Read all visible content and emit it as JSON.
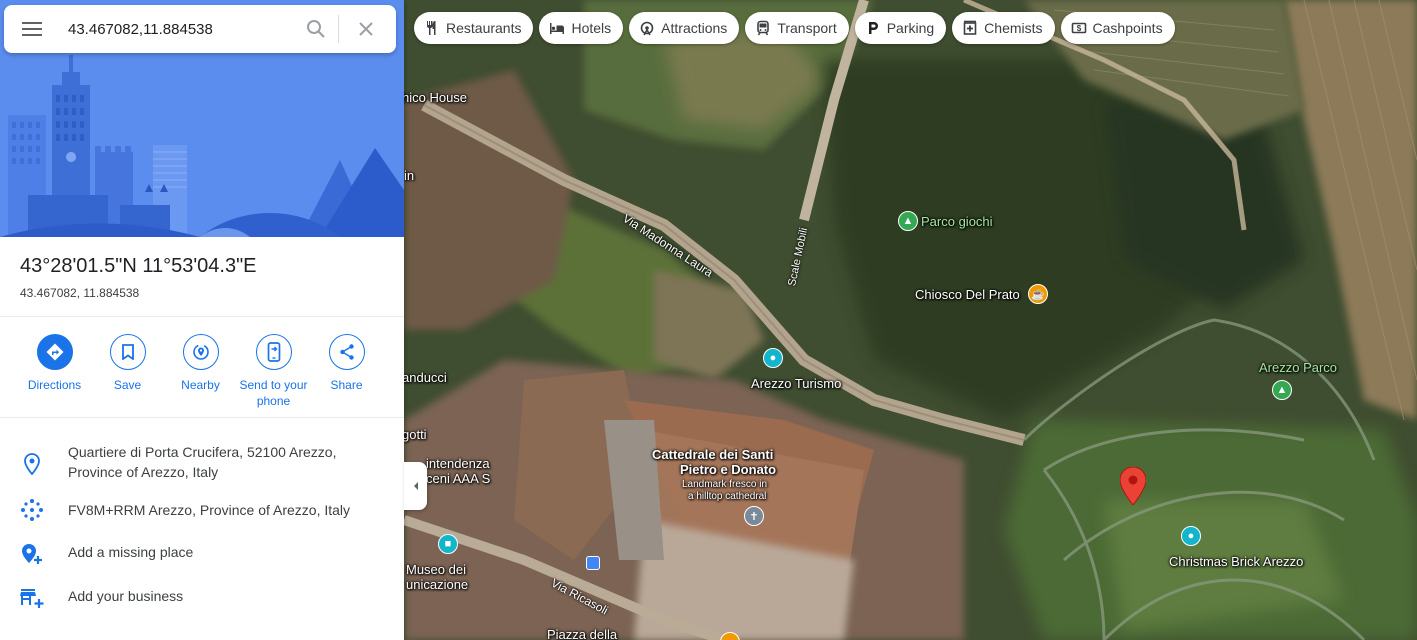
{
  "search": {
    "value": "43.467082,11.884538",
    "menu_icon": "menu-icon",
    "search_icon": "search-icon",
    "close_icon": "close-icon"
  },
  "place": {
    "dms": "43°28'01.5\"N 11°53'04.3\"E",
    "decimal": "43.467082, 11.884538"
  },
  "actions": [
    {
      "label": "Directions",
      "icon": "directions-icon"
    },
    {
      "label": "Save",
      "icon": "bookmark-icon"
    },
    {
      "label": "Nearby",
      "icon": "nearby-icon"
    },
    {
      "label": "Send to your phone",
      "icon": "phone-icon"
    },
    {
      "label": "Share",
      "icon": "share-icon"
    }
  ],
  "info": [
    {
      "text": "Quartiere di Porta Crucifera, 52100 Arezzo, Province of Arezzo, Italy",
      "icon": "location-pin-icon"
    },
    {
      "text": "FV8M+RRM Arezzo, Province of Arezzo, Italy",
      "icon": "plus-code-icon"
    },
    {
      "text": "Add a missing place",
      "icon": "add-place-icon"
    },
    {
      "text": "Add your business",
      "icon": "add-business-icon"
    }
  ],
  "chips": [
    {
      "label": "Restaurants",
      "icon": "restaurant-icon"
    },
    {
      "label": "Hotels",
      "icon": "hotel-icon"
    },
    {
      "label": "Attractions",
      "icon": "attractions-icon"
    },
    {
      "label": "Transport",
      "icon": "transport-icon"
    },
    {
      "label": "Parking",
      "icon": "parking-icon"
    },
    {
      "label": "Chemists",
      "icon": "chemist-icon"
    },
    {
      "label": "Cashpoints",
      "icon": "cashpoint-icon"
    }
  ],
  "map": {
    "labels": {
      "chico_house": "hico House",
      "in": "in",
      "anducci": "anducci",
      "gotti": "gotti",
      "intendenza": "intendenza",
      "ceni_aaa": "ceni AAA S",
      "parco_giochi": "Parco giochi",
      "chiosco": "Chiosco Del Prato",
      "arezzo_turismo": "Arezzo Turismo",
      "arezzo_parco": "Arezzo Parco",
      "cattedrale_1": "Cattedrale dei Santi",
      "cattedrale_2": "Pietro e Donato",
      "cattedrale_desc_1": "Landmark fresco in",
      "cattedrale_desc_2": "a hilltop cathedral",
      "museo_1": "Museo dei",
      "museo_2": "unicazione",
      "christmas": "Christmas Brick Arezzo",
      "piazza": "Piazza della"
    },
    "roads": {
      "madonna_laura": "Via Madonna Laura",
      "scale_mobili": "Scale Mobili",
      "ricasoli": "Via Ricasoli"
    },
    "marker_icon": "red-location-marker-icon"
  },
  "colors": {
    "accent": "#1a73e8",
    "marker": "#ea4335"
  }
}
